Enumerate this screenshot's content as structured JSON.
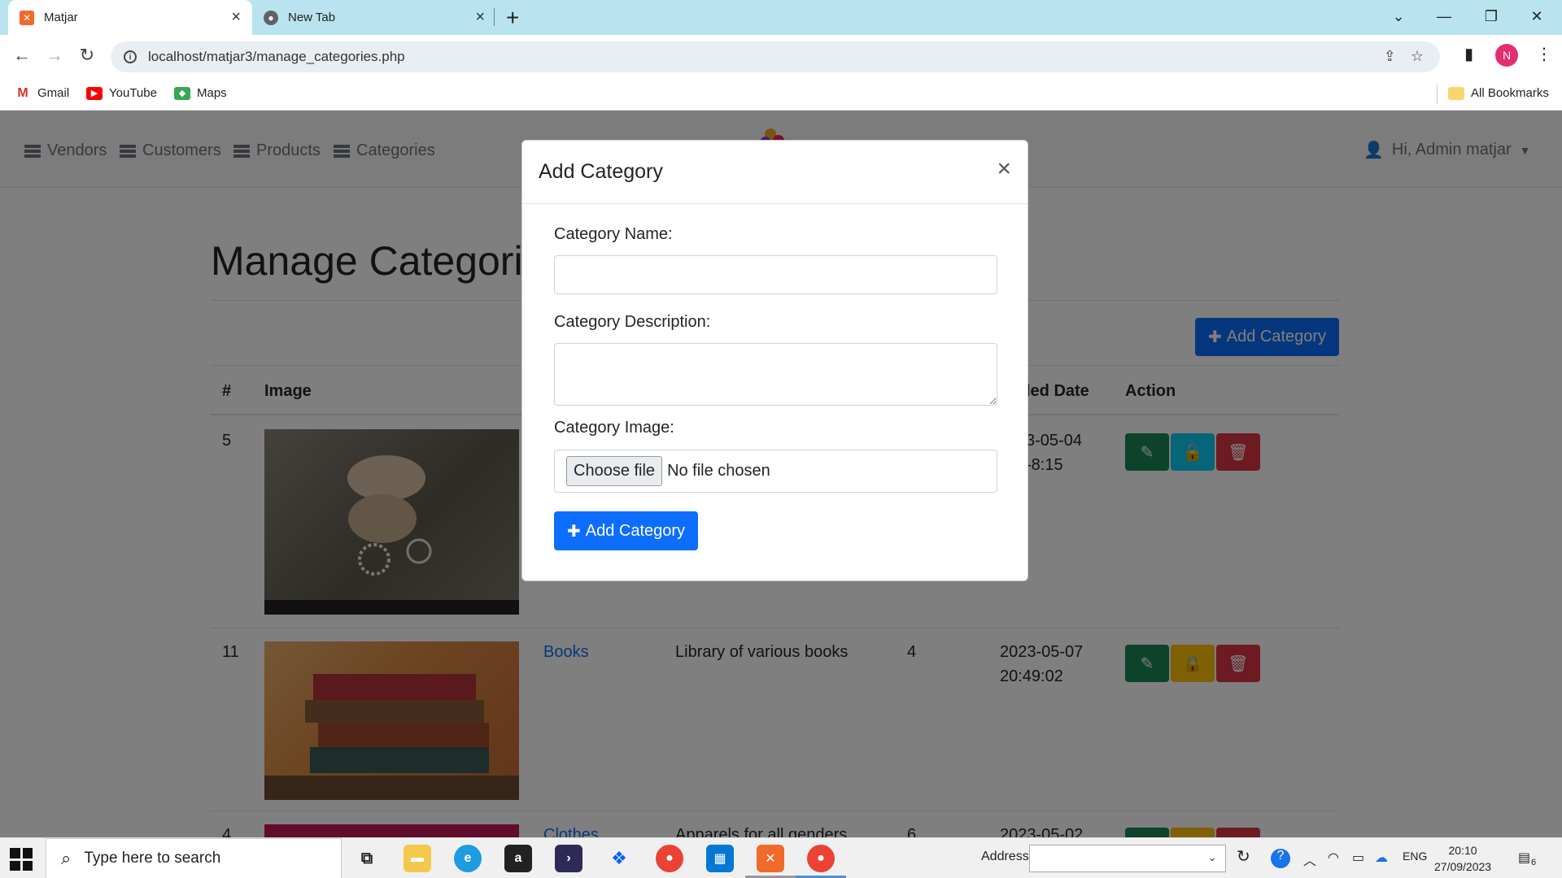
{
  "browser": {
    "tabs": [
      {
        "title": "Matjar",
        "active": true
      },
      {
        "title": "New Tab",
        "active": false
      }
    ],
    "url": "localhost/matjar3/manage_categories.php",
    "profile_initial": "N",
    "bookmarks": [
      "Gmail",
      "YouTube",
      "Maps"
    ],
    "all_bookmarks": "All Bookmarks"
  },
  "app": {
    "nav": [
      "Vendors",
      "Customers",
      "Products",
      "Categories"
    ],
    "user_greeting": "Hi, Admin matjar",
    "page_title": "Manage Categori",
    "add_button": "Add Category",
    "table": {
      "headers": [
        "#",
        "Image",
        "led Date",
        "Action"
      ],
      "rows": [
        {
          "id": "5",
          "name": "",
          "description": "",
          "count": "",
          "date": "3-05-04",
          "time": "-8:15",
          "lock": "unlocked"
        },
        {
          "id": "11",
          "name": "Books",
          "description": "Library of various books",
          "count": "4",
          "date": "2023-05-07",
          "time": "20:49:02",
          "lock": "locked"
        },
        {
          "id": "4",
          "name": "Clothes",
          "description": "Apparels for all genders",
          "count": "6",
          "date": "2023-05-02",
          "time": "",
          "lock": "locked"
        }
      ]
    }
  },
  "modal": {
    "title": "Add Category",
    "name_label": "Category Name:",
    "name_value": "",
    "description_label": "Category Description:",
    "description_value": "",
    "image_label": "Category Image:",
    "choose_file": "Choose file",
    "no_file": "No file chosen",
    "submit": "Add Category",
    "close": "×"
  },
  "taskbar": {
    "search_placeholder": "Type here to search",
    "address_label": "Address",
    "language": "ENG",
    "time": "20:10",
    "date": "27/09/2023",
    "notifications": "6"
  },
  "colors": {
    "primary": "#0d6efd",
    "success": "#198754",
    "info": "#0dcaf0",
    "warning": "#ffc107",
    "danger": "#dc3545",
    "tabstrip": "#b9e4ef"
  }
}
